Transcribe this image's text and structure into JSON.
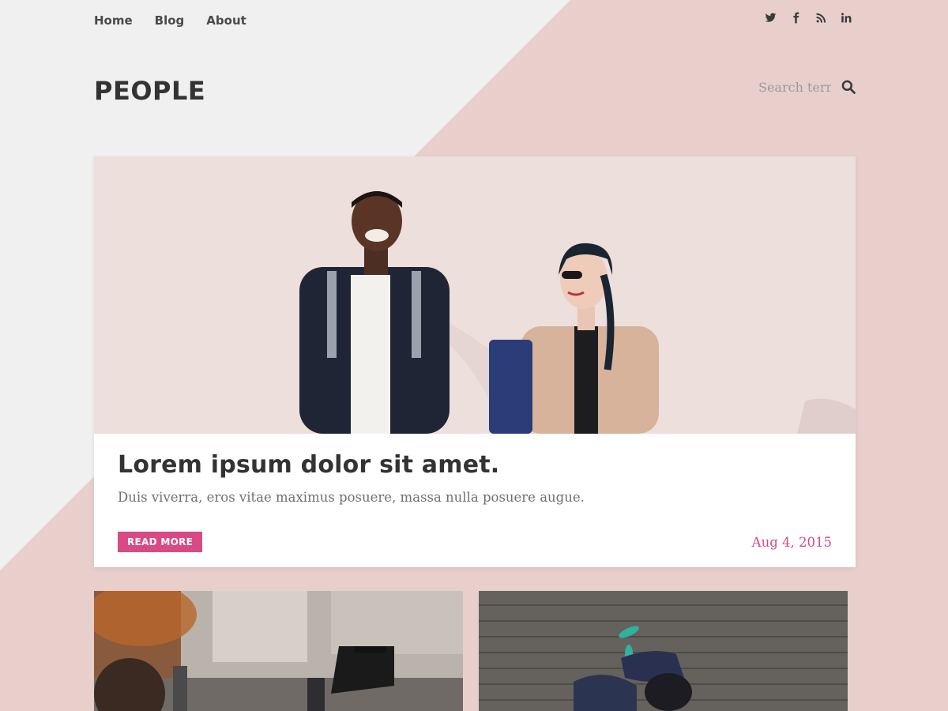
{
  "nav": {
    "items": [
      {
        "label": "Home"
      },
      {
        "label": "Blog"
      },
      {
        "label": "About"
      }
    ]
  },
  "social": [
    "twitter-icon",
    "facebook-icon",
    "rss-icon",
    "linkedin-icon"
  ],
  "page": {
    "title": "PEOPLE"
  },
  "search": {
    "placeholder": "Search term"
  },
  "featured": {
    "title": "Lorem ipsum dolor sit amet.",
    "excerpt": "Duis viverra, eros vitae maximus posuere, massa nulla posuere augue.",
    "read_more": "READ MORE",
    "date": "Aug 4, 2015"
  },
  "colors": {
    "background": "#f0f0f0",
    "pink_band": "#e8cfcc",
    "accent": "#d94a84",
    "text": "#333333"
  }
}
